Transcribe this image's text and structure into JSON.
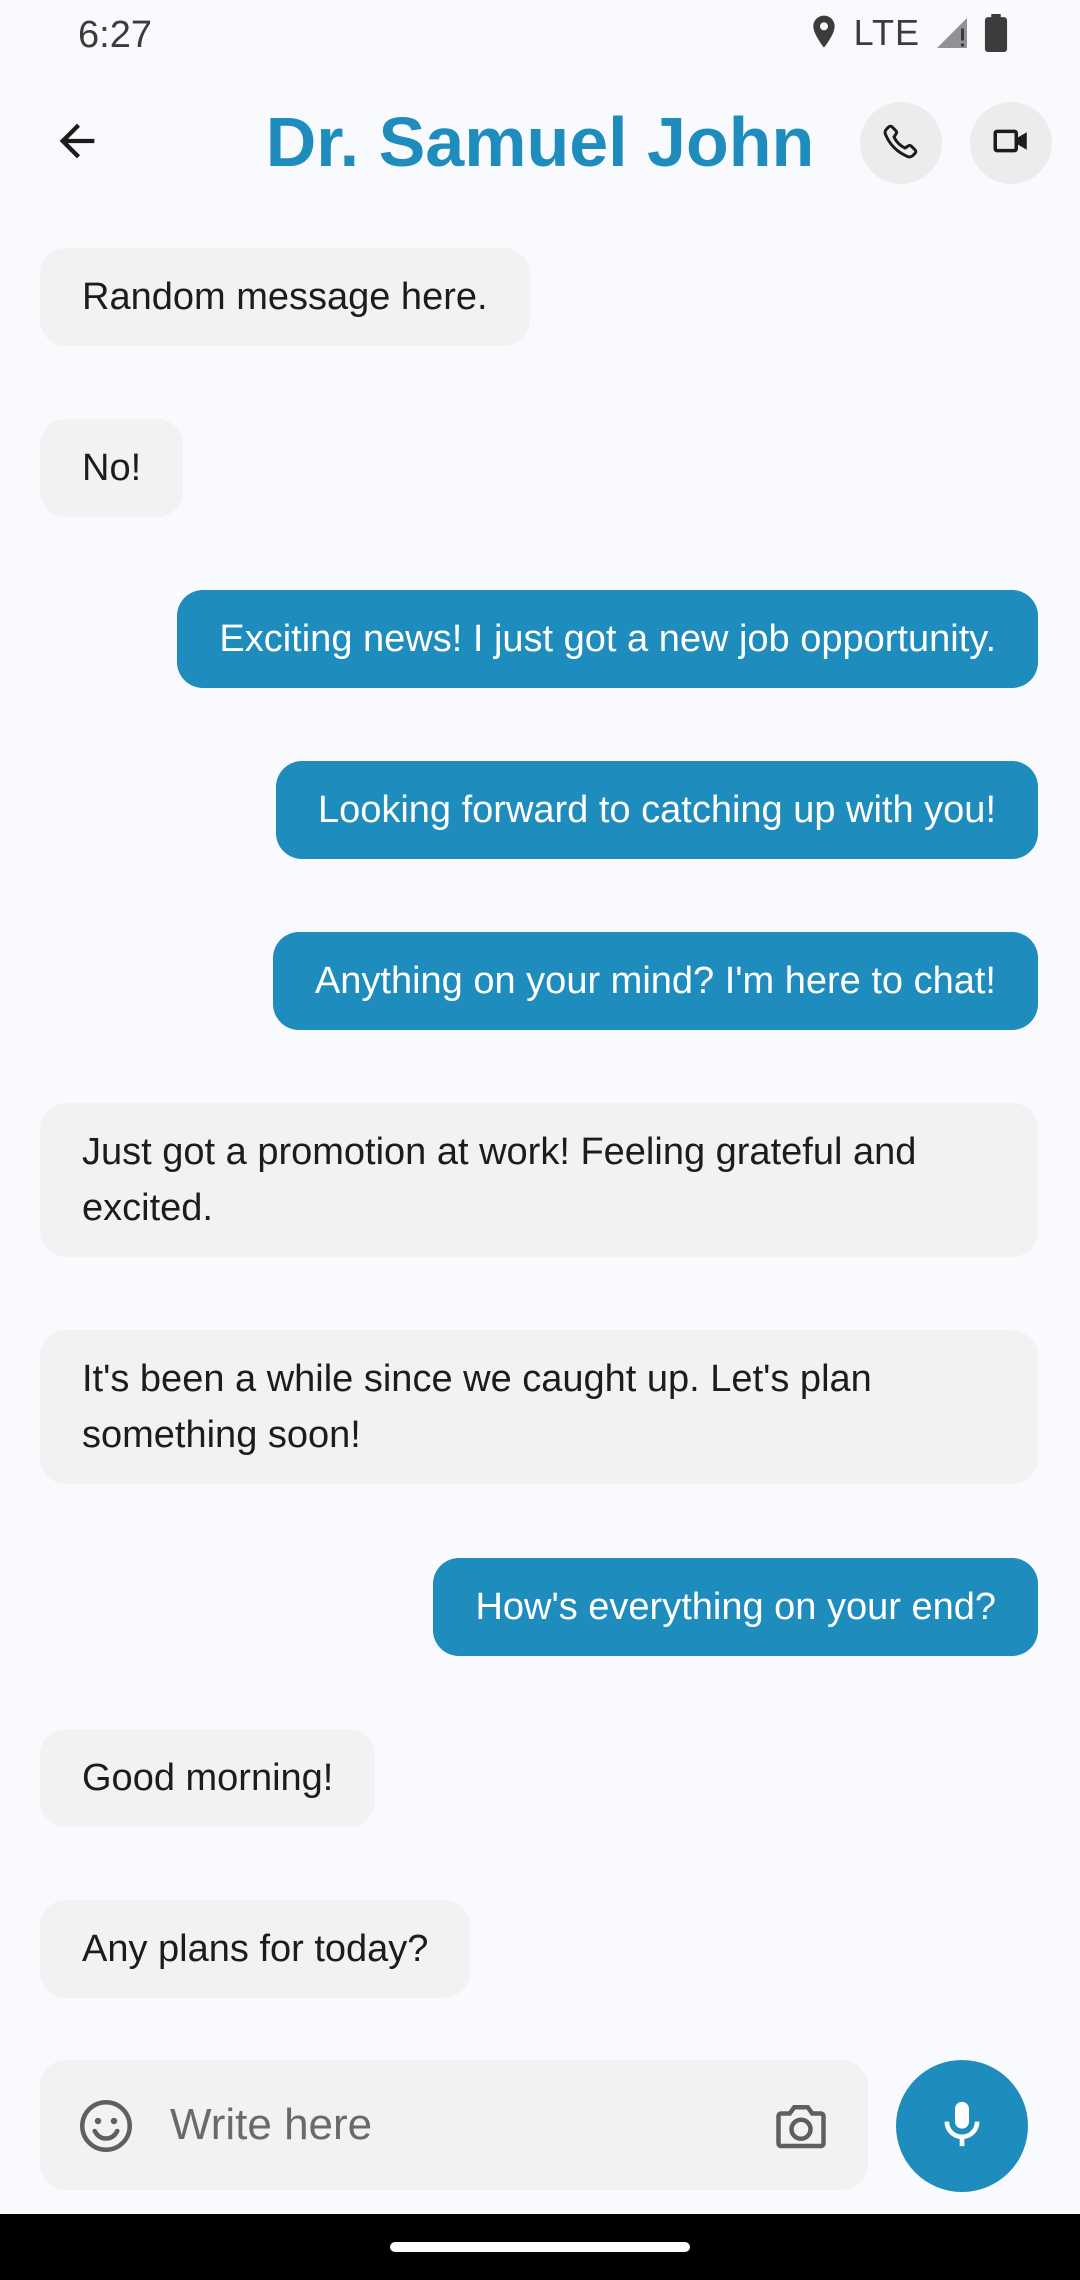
{
  "status_bar": {
    "time": "6:27",
    "network": "LTE",
    "icons": [
      "location-icon",
      "signal-icon",
      "battery-icon"
    ]
  },
  "header": {
    "back_icon": "arrow-left-icon",
    "title": "Dr. Samuel John",
    "call_icon": "phone-icon",
    "video_icon": "video-camera-icon"
  },
  "messages": [
    {
      "text": "Random message here.",
      "direction": "in"
    },
    {
      "text": "No!",
      "direction": "in"
    },
    {
      "text": "Exciting news! I just got a new job opportunity.",
      "direction": "out"
    },
    {
      "text": "Looking forward to catching up with you!",
      "direction": "out"
    },
    {
      "text": "Anything on your mind? I'm here to chat!",
      "direction": "out"
    },
    {
      "text": "Just got a promotion at work! Feeling grateful and excited.",
      "direction": "in"
    },
    {
      "text": "It's been a while since we caught up. Let's plan something soon!",
      "direction": "in"
    },
    {
      "text": "How's everything on your end?",
      "direction": "out"
    },
    {
      "text": "Good morning!",
      "direction": "in"
    },
    {
      "text": "Any plans for today?",
      "direction": "in"
    }
  ],
  "composer": {
    "placeholder": "Write here",
    "emoji_icon": "emoji-icon",
    "camera_icon": "camera-icon",
    "mic_icon": "microphone-icon"
  },
  "colors": {
    "accent": "#1e8cbc",
    "incoming_bubble": "#f2f2f2",
    "background": "#f9fafd"
  }
}
